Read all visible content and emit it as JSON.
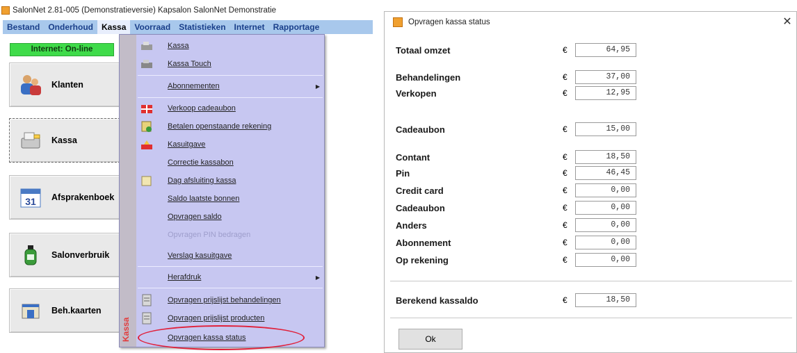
{
  "app": {
    "title": "SalonNet 2.81-005 (Demonstratieversie) Kapsalon SalonNet Demonstratie",
    "menubar": [
      "Bestand",
      "Onderhoud",
      "Kassa",
      "Voorraad",
      "Statistieken",
      "Internet",
      "Rapportage"
    ],
    "active_menu": "Kassa",
    "status_online": "Internet: On-line",
    "nav_buttons": {
      "klanten": "Klanten",
      "kassa": "Kassa",
      "afspraken": "Afsprakenboek",
      "salonverbruik": "Salonverbruik",
      "behkaarten": "Beh.kaarten"
    }
  },
  "kassa_menu": {
    "side_label": "Kassa",
    "items": {
      "kassa": "Kassa",
      "kassa_touch": "Kassa Touch",
      "abonnementen": "Abonnementen",
      "verkoop_cadeaubon": "Verkoop cadeaubon",
      "betalen_openstaande": "Betalen openstaande rekening",
      "kasuitgave": "Kasuitgave",
      "correctie_kassabon": "Correctie kassabon",
      "dag_afsluiting": "Dag afsluiting kassa",
      "saldo_laatste": "Saldo laatste bonnen",
      "opvragen_saldo": "Opvragen saldo",
      "opvragen_pin": "Opvragen PIN bedragen",
      "verslag_kasuitgave": "Verslag kasuitgave",
      "herafdruk": "Herafdruk",
      "prijslijst_behandelingen": "Opvragen prijslijst behandelingen",
      "prijslijst_producten": "Opvragen prijslijst producten",
      "kassa_status": "Opvragen kassa status"
    }
  },
  "dialog": {
    "title": "Opvragen kassa status",
    "close_glyph": "✕",
    "currency": "€",
    "rows": {
      "totaal_omzet": {
        "label": "Totaal omzet",
        "value": "64,95"
      },
      "behandelingen": {
        "label": "Behandelingen",
        "value": "37,00"
      },
      "verkopen": {
        "label": "Verkopen",
        "value": "12,95"
      },
      "cadeaubon_1": {
        "label": "Cadeaubon",
        "value": "15,00"
      },
      "contant": {
        "label": "Contant",
        "value": "18,50"
      },
      "pin": {
        "label": "Pin",
        "value": "46,45"
      },
      "credit_card": {
        "label": "Credit card",
        "value": "0,00"
      },
      "cadeaubon_2": {
        "label": "Cadeaubon",
        "value": "0,00"
      },
      "anders": {
        "label": "Anders",
        "value": "0,00"
      },
      "abonnement": {
        "label": "Abonnement",
        "value": "0,00"
      },
      "op_rekening": {
        "label": "Op rekening",
        "value": "0,00"
      },
      "berekend_kassaldo": {
        "label": "Berekend kassaldo",
        "value": "18,50"
      }
    },
    "ok_label": "Ok"
  },
  "colors": {
    "menubar_bg": "#a8c8ec",
    "menu_text": "#1a3f8a",
    "dropdown_bg": "#c7c7f1",
    "online_green": "#3fdb4a",
    "highlight_red": "#e0203a",
    "side_label_red": "#e23c3c"
  },
  "icons": {
    "app": "salonnet-app-icon",
    "klanten": "people-icon",
    "kassa": "cash-register-icon",
    "afspraken": "calendar-icon",
    "salonverbruik": "bottle-icon",
    "behkaarten": "card-file-icon"
  }
}
